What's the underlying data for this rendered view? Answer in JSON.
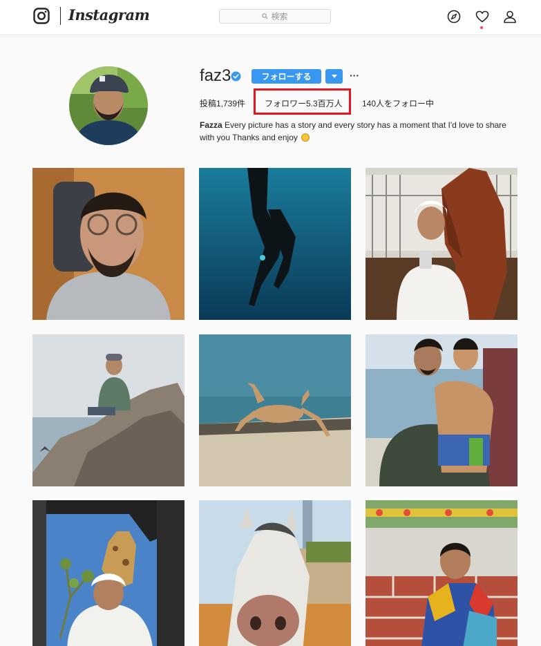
{
  "header": {
    "brand": "Instagram",
    "search_placeholder": "検索"
  },
  "profile": {
    "username": "faz3",
    "follow_label": "フォローする",
    "posts": "投稿1,739件",
    "followers": "フォロワー5.3百万人",
    "following": "140人をフォロー中",
    "bio_name": "Fazza",
    "bio_text": "Every picture has a story and every story has a moment that I'd love to share with you Thanks and enjoy"
  },
  "icons": {
    "logo": "instagram-glyph-icon",
    "search": "magnifier-icon",
    "explore": "compass-icon",
    "activity": "heart-icon",
    "profile": "person-icon",
    "verified": "verified-badge-icon",
    "dropdown": "caret-down-icon",
    "more": "ellipsis-icon"
  },
  "colors": {
    "accent": "#3897f0",
    "highlight_box": "#e5161d",
    "notification_dot": "#ed4956"
  },
  "posts_grid": [
    "portrait-selfie",
    "underwater-freediver",
    "selfie-with-horse",
    "man-on-rock-by-sea",
    "gazelle-leaping-on-beach",
    "man-with-child-on-boat",
    "giraffe-at-car-window",
    "white-horse-closeup",
    "child-sitting-on-wall"
  ]
}
